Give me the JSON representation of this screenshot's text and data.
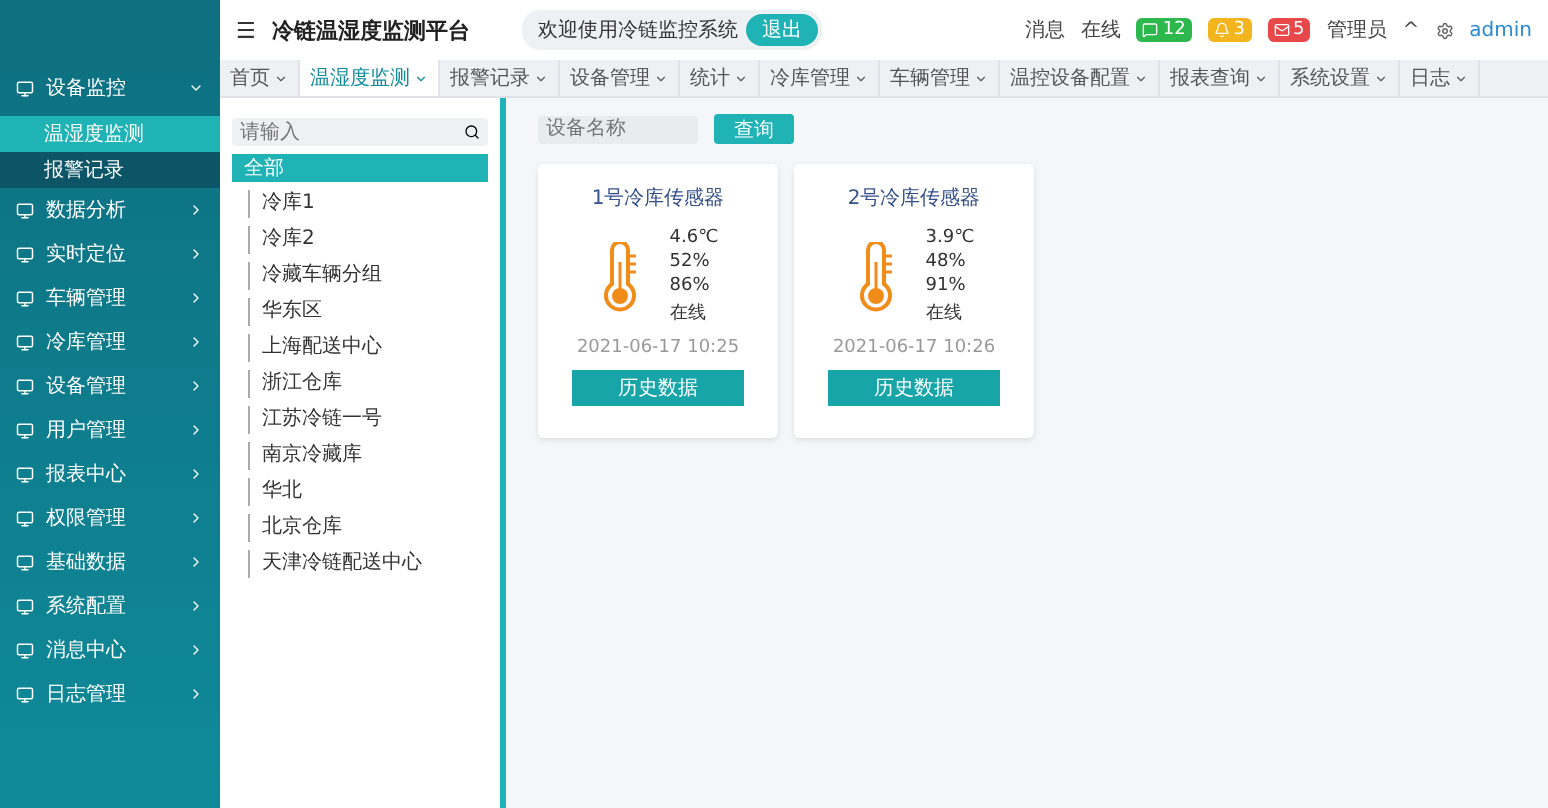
{
  "header": {
    "menu_glyph": "☰",
    "title": "冷链温湿度监测平台",
    "notice": {
      "text": "欢迎使用冷链监控系统",
      "button": "退出"
    },
    "links": [
      "消息",
      "在线"
    ],
    "badges": [
      {
        "label": "12",
        "color": "#2db84d"
      },
      {
        "label": "3",
        "color": "#f2b51d"
      },
      {
        "label": "5",
        "color": "#e8484a"
      }
    ],
    "user": "管理员",
    "caret": "^",
    "logout": "admin"
  },
  "tabs": [
    {
      "label": "首页",
      "selected": false
    },
    {
      "label": "温湿度监测",
      "selected": true
    },
    {
      "label": "报警记录",
      "selected": false
    },
    {
      "label": "设备管理",
      "selected": false
    },
    {
      "label": "统计",
      "selected": false
    },
    {
      "label": "冷库管理",
      "selected": false
    },
    {
      "label": "车辆管理",
      "selected": false
    },
    {
      "label": "温控设备配置",
      "selected": false
    },
    {
      "label": "报表查询",
      "selected": false
    },
    {
      "label": "系统设置",
      "selected": false
    },
    {
      "label": "日志",
      "selected": false
    }
  ],
  "sidebar": {
    "items": [
      {
        "label": "设备监控",
        "expanded": true,
        "children": [
          {
            "label": "温湿度监测",
            "selected": true
          },
          {
            "label": "报警记录",
            "selected": false
          }
        ]
      },
      {
        "label": "数据分析",
        "expanded": false
      },
      {
        "label": "实时定位",
        "expanded": false
      },
      {
        "label": "车辆管理",
        "expanded": false
      },
      {
        "label": "冷库管理",
        "expanded": false
      },
      {
        "label": "设备管理",
        "expanded": false
      },
      {
        "label": "用户管理",
        "expanded": false
      },
      {
        "label": "报表中心",
        "expanded": false
      },
      {
        "label": "权限管理",
        "expanded": false
      },
      {
        "label": "基础数据",
        "expanded": false
      },
      {
        "label": "系统配置",
        "expanded": false
      },
      {
        "label": "消息中心",
        "expanded": false
      },
      {
        "label": "日志管理",
        "expanded": false
      }
    ]
  },
  "tree": {
    "placeholder": "请输入",
    "root": {
      "label": "全部",
      "selected": true,
      "children": [
        {
          "label": "冷库1"
        },
        {
          "label": "冷库2"
        },
        {
          "label": "冷藏车辆分组"
        },
        {
          "label": "华东区"
        },
        {
          "label": "上海配送中心"
        },
        {
          "label": "浙江仓库"
        },
        {
          "label": "江苏冷链一号"
        },
        {
          "label": "南京冷藏库"
        },
        {
          "label": "华北"
        },
        {
          "label": "北京仓库"
        },
        {
          "label": "天津冷链配送中心"
        }
      ]
    }
  },
  "toolbar": {
    "placeholder": "设备名称",
    "button": "查询"
  },
  "cards": [
    {
      "title": "1号冷库传感器",
      "readings": [
        "4.6℃",
        "52%",
        "86%",
        "在线"
      ],
      "time": "2021-06-17 10:25",
      "button": "历史数据"
    },
    {
      "title": "2号冷库传感器",
      "readings": [
        "3.9℃",
        "48%",
        "91%",
        "在线"
      ],
      "time": "2021-06-17 10:26",
      "button": "历史数据"
    }
  ]
}
